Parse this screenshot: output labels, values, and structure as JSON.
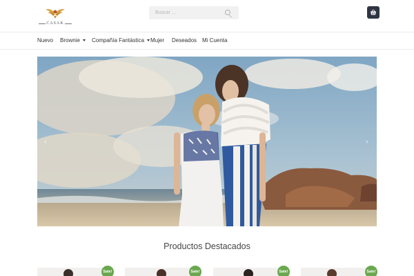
{
  "header": {
    "logo_text": "CASAK",
    "search": {
      "placeholder": "Buscar ..."
    },
    "cart_icon": "cart-icon"
  },
  "nav": {
    "items": [
      {
        "label": "Nuevo",
        "dropdown": false
      },
      {
        "label": "Brownie",
        "dropdown": true
      },
      {
        "label": "Compañía Fantástica",
        "dropdown": true
      },
      {
        "label": "Mujer",
        "dropdown": false
      },
      {
        "label": "Deseados",
        "dropdown": false
      },
      {
        "label": "Mi Cuenta",
        "dropdown": false
      }
    ]
  },
  "hero": {
    "prev_icon": "chevron-left-icon",
    "next_icon": "chevron-right-icon",
    "prev_glyph": "‹",
    "next_glyph": "›"
  },
  "featured": {
    "title": "Productos Destacados",
    "products": [
      {
        "badge": "Sale!"
      },
      {
        "badge": "Sale!"
      },
      {
        "badge": "Sale!"
      },
      {
        "badge": "Sale!"
      }
    ]
  },
  "colors": {
    "cart_bg": "#2f3542",
    "sale_badge": "#6aa84f"
  }
}
